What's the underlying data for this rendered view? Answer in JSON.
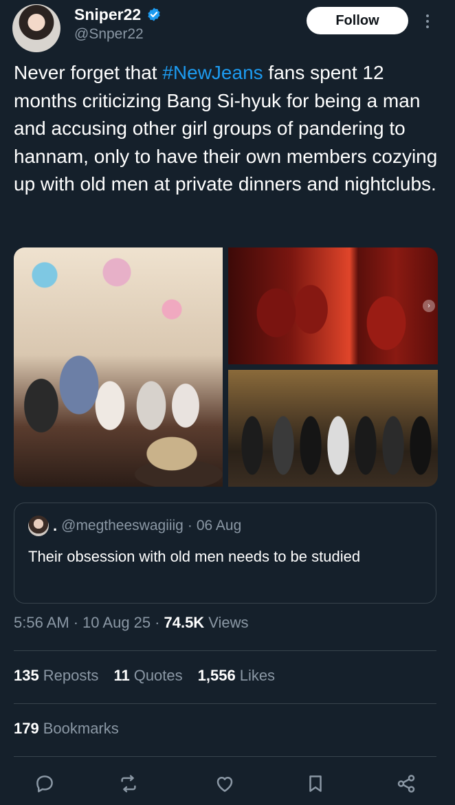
{
  "author": {
    "name": "Sniper22",
    "handle": "@Snper22",
    "avatar_icon": "profile-photo",
    "verified_icon": "verified-badge-icon"
  },
  "header": {
    "follow_label": "Follow",
    "more_icon": "more-vertical-icon"
  },
  "tweet": {
    "text_before": "Never forget that ",
    "hashtag": "#NewJeans",
    "text_after": " fans spent 12 months criticizing Bang Si-hyuk for being a man and accusing other girl groups of pandering to hannam, only to have their own members cozying up with old men at private dinners and nightclubs."
  },
  "media": {
    "photos": [
      {
        "description_icon": "photo-party-dinner"
      },
      {
        "description_icon": "photo-red-lit-selfie"
      },
      {
        "description_icon": "photo-group-standing"
      }
    ]
  },
  "quote": {
    "dot": ".",
    "handle": "@megtheeswagiiig",
    "separator": "·",
    "date": "06 Aug",
    "text": "Their obsession with old men needs to be studied"
  },
  "meta": {
    "time": "5:56 AM",
    "sep1": "·",
    "date": "10 Aug 25",
    "sep2": "·",
    "views_count": "74.5K",
    "views_label": "Views"
  },
  "stats": {
    "reposts_count": "135",
    "reposts_label": "Reposts",
    "quotes_count": "11",
    "quotes_label": "Quotes",
    "likes_count": "1,556",
    "likes_label": "Likes",
    "bookmarks_count": "179",
    "bookmarks_label": "Bookmarks"
  },
  "actions": [
    "reply-icon",
    "repost-icon",
    "like-icon",
    "bookmark-icon",
    "share-icon"
  ],
  "colors": {
    "background": "#15202b",
    "accent": "#1d9bf0",
    "muted": "#8b98a5",
    "divider": "#38444d"
  }
}
